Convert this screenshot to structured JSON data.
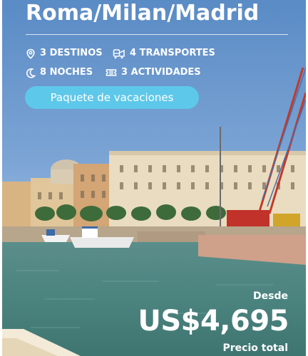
{
  "package": {
    "title": "Roma/Milan/Madrid",
    "stats": {
      "destinations": "3 DESTINOS",
      "transports": "4 TRANSPORTES",
      "nights": "8 NOCHES",
      "activities": "3 ACTIVIDADES"
    },
    "badge": "Paquete de vacaciones"
  },
  "pricing": {
    "from_label": "Desde",
    "price": "US$4,695",
    "note": "Precio total"
  },
  "icons": [
    "location-pin-icon",
    "transport-icon",
    "moon-icon",
    "ticket-icon"
  ],
  "colors": {
    "accent": "#5ec8ea",
    "sky": "#5f8fc6",
    "water": "#4f8b88"
  }
}
